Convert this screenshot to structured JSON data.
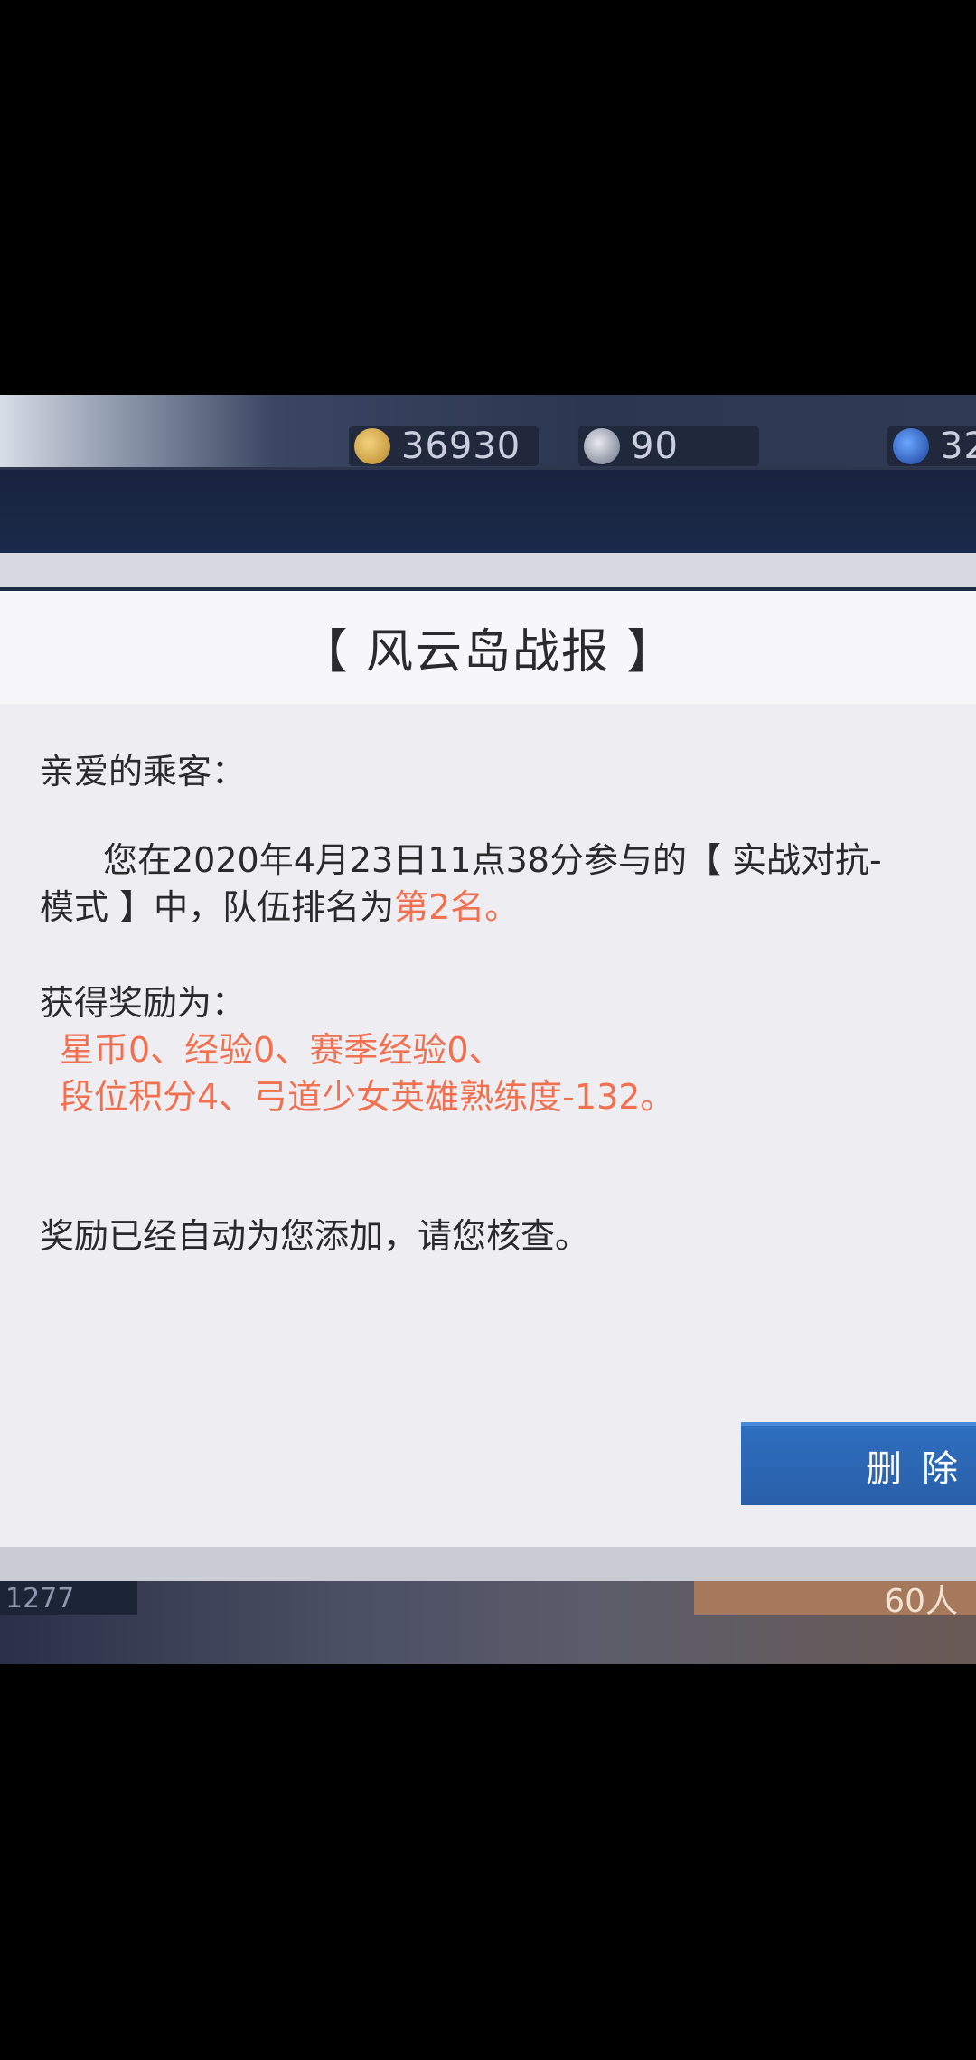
{
  "resources": [
    {
      "icon": "gold-coin-icon",
      "value": "36930"
    },
    {
      "icon": "feather-icon",
      "value": "90"
    },
    {
      "icon": "blue-gem-icon",
      "value": "32"
    }
  ],
  "mail": {
    "title": "【 风云岛战报 】",
    "greeting": "亲爱的乘客：",
    "body_line1_pre": "您在2020年4月23日11点38分参与的【 实战对抗-",
    "body_line2_pre": "模式 】中，队伍排名为",
    "body_rank": "第2名。",
    "reward_heading": "获得奖励为：",
    "reward_line1": "星币0、经验0、赛季经验0、",
    "reward_line2": "段位积分4、弓道少女英雄熟练度-132。",
    "footer": "奖励已经自动为您添加，请您核查。",
    "delete_label": "删除"
  },
  "bottom": {
    "left_text": "1277",
    "right_text": "60人"
  },
  "colors": {
    "highlight": "#f07050",
    "button": "#2d6fc0",
    "dialog_bg": "#eeedf1"
  }
}
